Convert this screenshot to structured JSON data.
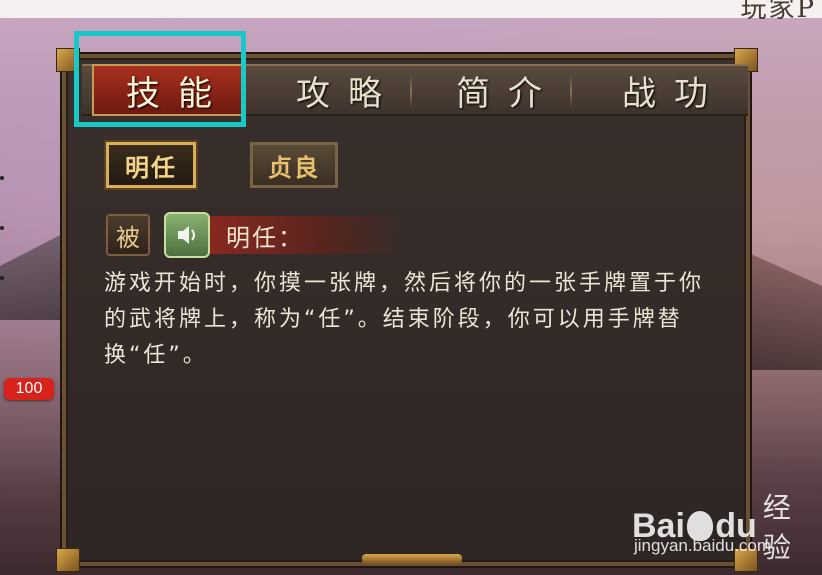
{
  "top_right_text": "玩家P",
  "hp_badge": "100",
  "tabs": [
    {
      "label": "技能",
      "active": true
    },
    {
      "label": "攻略",
      "active": false
    },
    {
      "label": "简介",
      "active": false
    },
    {
      "label": "战功",
      "active": false
    }
  ],
  "skill_buttons": [
    {
      "label": "明任",
      "selected": true
    },
    {
      "label": "贞良",
      "selected": false
    }
  ],
  "skill_detail": {
    "type_badge": "被",
    "audio_icon": "speaker-icon",
    "name": "明任：",
    "description": "游戏开始时，你摸一张牌，然后将你的一张手牌置于你的武将牌上，称为“任”。结束阶段，你可以用手牌替换“任”。"
  },
  "colors": {
    "highlight": "#19c8c8",
    "active_tab": "#a8301e",
    "hp_badge": "#d8221c"
  },
  "watermark": {
    "brand": "Bai",
    "brand_suffix": "du",
    "cn": "经验",
    "url": "jingyan.baidu.com"
  }
}
